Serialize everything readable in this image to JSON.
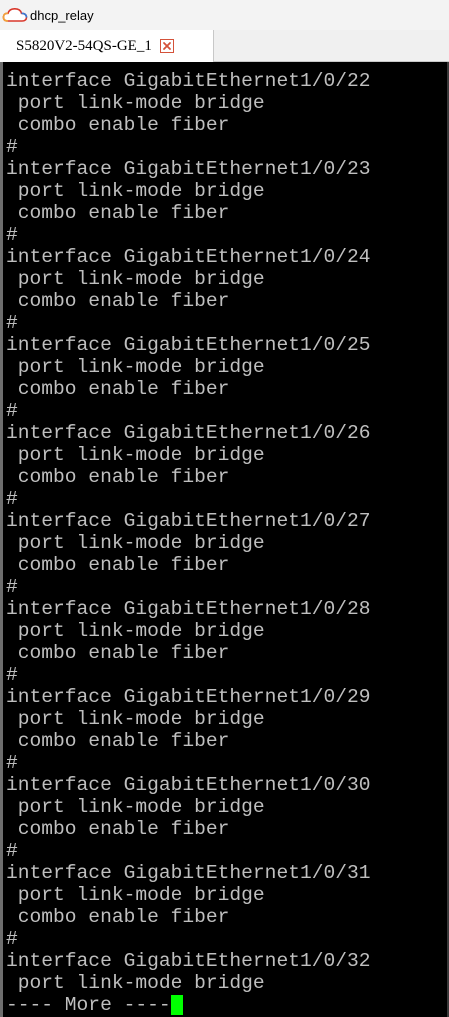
{
  "window": {
    "title": "dhcp_relay",
    "icon": "cloud-icon"
  },
  "tabs": [
    {
      "label": "S5820V2-54QS-GE_1",
      "close_icon": "close-icon",
      "active": true
    }
  ],
  "colors": {
    "terminal_bg": "#000000",
    "terminal_fg": "#bfbfbf",
    "cursor": "#00ff00",
    "close_accent": "#d4523a"
  },
  "terminal": {
    "lines": [
      "interface GigabitEthernet1/0/22",
      " port link-mode bridge",
      " combo enable fiber",
      "#",
      "interface GigabitEthernet1/0/23",
      " port link-mode bridge",
      " combo enable fiber",
      "#",
      "interface GigabitEthernet1/0/24",
      " port link-mode bridge",
      " combo enable fiber",
      "#",
      "interface GigabitEthernet1/0/25",
      " port link-mode bridge",
      " combo enable fiber",
      "#",
      "interface GigabitEthernet1/0/26",
      " port link-mode bridge",
      " combo enable fiber",
      "#",
      "interface GigabitEthernet1/0/27",
      " port link-mode bridge",
      " combo enable fiber",
      "#",
      "interface GigabitEthernet1/0/28",
      " port link-mode bridge",
      " combo enable fiber",
      "#",
      "interface GigabitEthernet1/0/29",
      " port link-mode bridge",
      " combo enable fiber",
      "#",
      "interface GigabitEthernet1/0/30",
      " port link-mode bridge",
      " combo enable fiber",
      "#",
      "interface GigabitEthernet1/0/31",
      " port link-mode bridge",
      " combo enable fiber",
      "#",
      "interface GigabitEthernet1/0/32",
      " port link-mode bridge"
    ],
    "more_prompt": "---- More ----"
  }
}
